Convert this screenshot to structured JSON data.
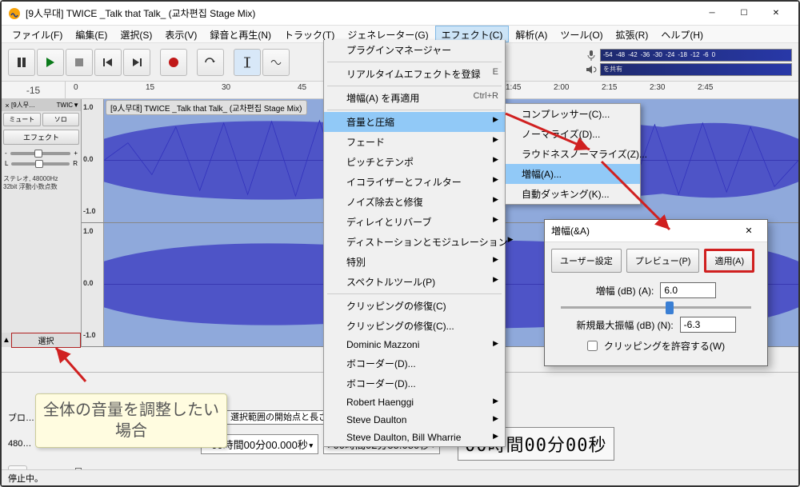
{
  "titlebar": {
    "title": "[9人무대] TWICE _Talk that Talk_ (교차편집 Stage Mix)"
  },
  "menubar": {
    "file": "ファイル(F)",
    "edit": "編集(E)",
    "select": "選択(S)",
    "view": "表示(V)",
    "record": "録音と再生(N)",
    "track": "トラック(T)",
    "generate": "ジェネレーター(G)",
    "effect": "エフェクト(C)",
    "analyze": "解析(A)",
    "tools": "ツール(O)",
    "extend": "拡張(R)",
    "help": "ヘルプ(H)"
  },
  "meter_ticks": [
    "-54",
    "-48",
    "-42",
    "-36",
    "-30",
    "-24",
    "-18",
    "-12",
    "-6",
    "0"
  ],
  "share_hint": "を共有",
  "timeline": {
    "start": "-15",
    "ticks": [
      {
        "pos": 10,
        "t": "0"
      },
      {
        "pos": 100,
        "t": "15"
      },
      {
        "pos": 195,
        "t": "30"
      },
      {
        "pos": 290,
        "t": "45"
      },
      {
        "pos": 550,
        "t": "1:45"
      },
      {
        "pos": 610,
        "t": "2:00"
      },
      {
        "pos": 670,
        "t": "2:15"
      },
      {
        "pos": 730,
        "t": "2:30"
      },
      {
        "pos": 790,
        "t": "2:45"
      }
    ]
  },
  "track": {
    "header_name": "[9人무…",
    "header_twic": "TWIC",
    "mute": "ミュート",
    "solo": "ソロ",
    "effect": "エフェクト",
    "gain_minus": "-",
    "gain_plus": "+",
    "pan_l": "L",
    "pan_r": "R",
    "info1": "ステレオ, 48000Hz",
    "info2": "32bit 浮動小数点数",
    "select_label": "選択",
    "file_label": "[9人무대] TWICE _Talk that Talk_ (교차편집 Stage Mix)",
    "scale_top": "1.0",
    "scale_mid": "0.0",
    "scale_bot": "-1.0"
  },
  "dropdown": {
    "plugin_mgr": "プラグインマネージャー",
    "realtime": "リアルタイムエフェクトを登録",
    "realtime_key": "E",
    "reapply": "増幅(A) を再適用",
    "reapply_key": "Ctrl+R",
    "volume": "音量と圧縮",
    "fade": "フェード",
    "pitch": "ピッチとテンポ",
    "eq": "イコライザーとフィルター",
    "noise": "ノイズ除去と修復",
    "delay": "ディレイとリバーブ",
    "distortion": "ディストーションとモジュレーション",
    "special": "特別",
    "spectral": "スペクトルツール(P)",
    "clip_restore": "クリッピングの修復(C)",
    "clip_restore2": "クリッピングの修復(C)...",
    "dominic": "Dominic Mazzoni",
    "vocoder": "ボコーダー(D)...",
    "vocoder2": "ボコーダー(D)...",
    "robert": "Robert Haenggi",
    "steve": "Steve Daulton",
    "steve2": "Steve Daulton, Bill Wharrie"
  },
  "submenu": {
    "compressor": "コンプレッサー(C)...",
    "normalize": "ノーマライズ(D)...",
    "loudness": "ラウドネスノーマライズ(Z)...",
    "amplify": "増幅(A)...",
    "autoduck": "自動ダッキング(K)..."
  },
  "dialog": {
    "title": "増幅(&A)",
    "user_pref": "ユーザー設定",
    "preview": "プレビュー(P)",
    "apply": "適用(A)",
    "amp_label": "増幅 (dB) (A):",
    "amp_value": "6.0",
    "newpeak_label": "新規最大振幅 (dB) (N):",
    "newpeak_value": "-6.3",
    "clip_allow": "クリッピングを許容する(W)"
  },
  "bottom": {
    "bloc": "ブロ…",
    "freq": "480…",
    "range_label": "選択範囲の開始点と長さ",
    "start_time": "00時間00分00.000秒",
    "len_time": "00時間02分55.080秒",
    "big_time": "00時間00分00秒"
  },
  "status": "停止中。",
  "callout": "全体の音量を調整したい場合"
}
